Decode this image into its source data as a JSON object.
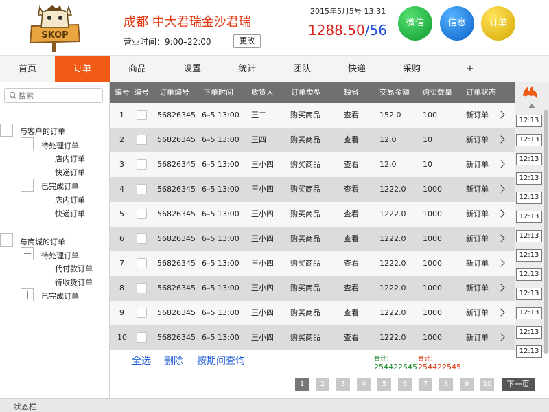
{
  "header": {
    "logo_text": "SKOP",
    "store_name": "成都 中大君瑞金沙君瑞",
    "hours_label": "营业时间：",
    "hours_value": "9:00–22:00",
    "change_button": "更改",
    "datetime": "2015年5月5号 13:31",
    "balance_main": "1288.50",
    "balance_sep": "/",
    "balance_count": "56",
    "wechat_button": "微信",
    "info_button": "信息",
    "order_button": "订单",
    "colors": {
      "accent": "#f05a14",
      "balance_red": "#d9241c",
      "balance_blue": "#1f4fd8",
      "wechat_green": "#1db83f",
      "info_blue": "#1a7ff0",
      "order_yellow": "#f2c40a"
    }
  },
  "nav": {
    "items": [
      {
        "label": "首页",
        "active": false
      },
      {
        "label": "订单",
        "active": true
      },
      {
        "label": "商品",
        "active": false
      },
      {
        "label": "设置",
        "active": false
      },
      {
        "label": "统计",
        "active": false
      },
      {
        "label": "团队",
        "active": false
      },
      {
        "label": "快递",
        "active": false
      },
      {
        "label": "采购",
        "active": false
      },
      {
        "label": "+",
        "active": false
      }
    ]
  },
  "sidebar": {
    "search_placeholder": "搜索",
    "search_icon": "search-icon",
    "tree": [
      {
        "label": "与客户的订单",
        "box": "minus"
      },
      {
        "label": "待处理订单",
        "box": "minus"
      },
      {
        "label": "店内订单",
        "box": ""
      },
      {
        "label": "快递订单",
        "box": ""
      },
      {
        "label": "已完成订单",
        "box": "minus"
      },
      {
        "label": "店内订单",
        "box": ""
      },
      {
        "label": "快递订单",
        "box": ""
      },
      {
        "label": "与商城的订单",
        "box": "minus"
      },
      {
        "label": "待处理订单",
        "box": "minus"
      },
      {
        "label": "代付款订单",
        "box": ""
      },
      {
        "label": "待收货订单",
        "box": ""
      },
      {
        "label": "已完成订单",
        "box": "plus"
      }
    ]
  },
  "table": {
    "headers": [
      "编号",
      "编号",
      "订单编号",
      "下单时间",
      "收货人",
      "订单类型",
      "缺省",
      "交易金额",
      "购买数量",
      "订单状态"
    ],
    "rows": [
      {
        "no": "1",
        "order_no": "56826345",
        "time": "6–5 13:00",
        "receiver": "王二",
        "type": "购买商品",
        "default": "查看",
        "amount": "152.0",
        "qty": "100",
        "status": "新订单"
      },
      {
        "no": "2",
        "order_no": "56826345",
        "time": "6–5 13:00",
        "receiver": "王四",
        "type": "购买商品",
        "default": "查看",
        "amount": "12.0",
        "qty": "10",
        "status": "新订单"
      },
      {
        "no": "3",
        "order_no": "56826345",
        "time": "6–5 13:00",
        "receiver": "王小四",
        "type": "购买商品",
        "default": "查看",
        "amount": "12.0",
        "qty": "10",
        "status": "新订单"
      },
      {
        "no": "4",
        "order_no": "56826345",
        "time": "6–5 13:00",
        "receiver": "王小四",
        "type": "购买商品",
        "default": "查看",
        "amount": "1222.0",
        "qty": "1000",
        "status": "新订单"
      },
      {
        "no": "5",
        "order_no": "56826345",
        "time": "6–5 13:00",
        "receiver": "王小四",
        "type": "购买商品",
        "default": "查看",
        "amount": "1222.0",
        "qty": "1000",
        "status": "新订单"
      },
      {
        "no": "6",
        "order_no": "56826345",
        "time": "6–5 13:00",
        "receiver": "王小四",
        "type": "购买商品",
        "default": "查看",
        "amount": "1222.0",
        "qty": "1000",
        "status": "新订单"
      },
      {
        "no": "7",
        "order_no": "56826345",
        "time": "6–5 13:00",
        "receiver": "王小四",
        "type": "购买商品",
        "default": "查看",
        "amount": "1222.0",
        "qty": "1000",
        "status": "新订单"
      },
      {
        "no": "8",
        "order_no": "56826345",
        "time": "6–5 13:00",
        "receiver": "王小四",
        "type": "购买商品",
        "default": "查看",
        "amount": "1222.0",
        "qty": "1000",
        "status": "新订单"
      },
      {
        "no": "9",
        "order_no": "56826345",
        "time": "6–5 13:00",
        "receiver": "王小四",
        "type": "购买商品",
        "default": "查看",
        "amount": "1222.0",
        "qty": "1000",
        "status": "新订单"
      },
      {
        "no": "10",
        "order_no": "56826345",
        "time": "6–5 13:00",
        "receiver": "王小四",
        "type": "购买商品",
        "default": "查看",
        "amount": "1222.0",
        "qty": "1000",
        "status": "新订单"
      }
    ]
  },
  "time_column": {
    "fire_icon": "fire-icon",
    "chips": [
      "12:13",
      "12:13",
      "12:13",
      "12:13",
      "12:13",
      "12:13",
      "12:13",
      "12:13",
      "12:13",
      "12:13",
      "12:13",
      "12:13",
      "12:13"
    ]
  },
  "actions": {
    "select_all": "全选",
    "delete": "删除",
    "query_by_period": "按期间查询",
    "total_label_1": "合计：",
    "total_value_1": "254422545",
    "total_label_2": "合计：",
    "total_value_2": "254422545"
  },
  "pagination": {
    "pages": [
      "1",
      "2",
      "3",
      "4",
      "5",
      "6",
      "7",
      "8",
      "9",
      "10"
    ],
    "current": "1",
    "next_label": "下一页"
  },
  "statusbar": {
    "text": "状态栏"
  }
}
